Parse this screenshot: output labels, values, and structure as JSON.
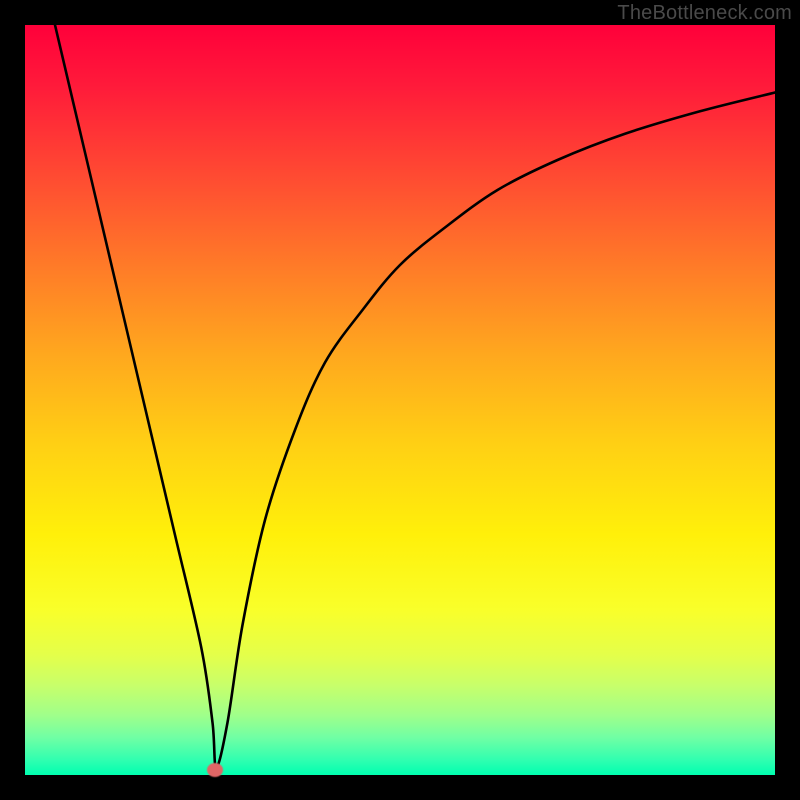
{
  "watermark": "TheBottleneck.com",
  "chart_data": {
    "type": "line",
    "title": "",
    "xlabel": "",
    "ylabel": "",
    "xlim": [
      0,
      100
    ],
    "ylim": [
      0,
      100
    ],
    "series": [
      {
        "name": "curve",
        "x": [
          4,
          8,
          12,
          16,
          20,
          23.5,
          25,
          25.5,
          27,
          29,
          32,
          36,
          40,
          45,
          50,
          56,
          63,
          71,
          80,
          90,
          100
        ],
        "y": [
          100,
          83,
          66,
          49,
          32,
          17,
          7,
          1,
          7,
          20,
          34,
          46,
          55,
          62,
          68,
          73,
          78,
          82,
          85.5,
          88.5,
          91
        ]
      }
    ],
    "marker": {
      "x": 25.3,
      "y": 0.7
    }
  },
  "colors": {
    "curve": "#000000",
    "marker": "#e06666",
    "frame": "#000000"
  }
}
